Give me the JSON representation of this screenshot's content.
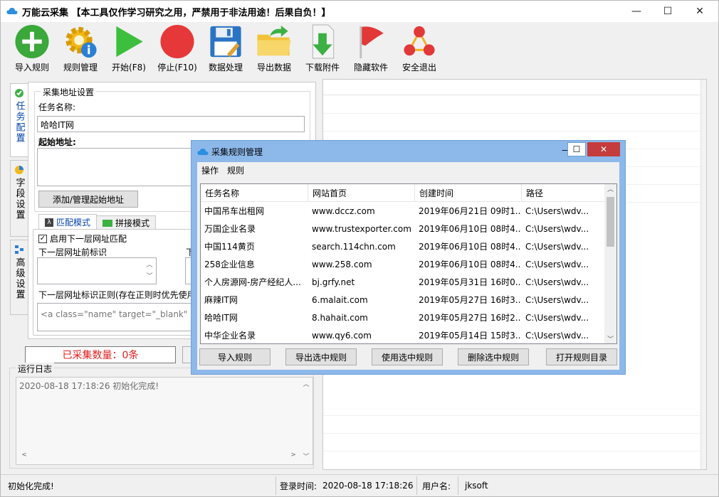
{
  "window": {
    "title": "万能云采集 【本工具仅作学习研究之用，严禁用于非法用途！后果自负！】",
    "minimize": "—",
    "maximize": "☐",
    "close": "✕"
  },
  "toolbar": {
    "items": [
      {
        "label": "导入规则",
        "icon": "add-circle-icon"
      },
      {
        "label": "规则管理",
        "icon": "gear-info-icon"
      },
      {
        "label": "开始(F8)",
        "icon": "play-icon"
      },
      {
        "label": "停止(F10)",
        "icon": "stop-icon"
      },
      {
        "label": "数据处理",
        "icon": "floppy-disk-icon"
      },
      {
        "label": "导出数据",
        "icon": "folder-export-icon"
      },
      {
        "label": "下载附件",
        "icon": "download-icon"
      },
      {
        "label": "隐藏软件",
        "icon": "red-flag-icon"
      },
      {
        "label": "安全退出",
        "icon": "exit-molecule-icon"
      }
    ]
  },
  "left_tabs": [
    {
      "label": "任务配置",
      "active": true
    },
    {
      "label": "字段设置",
      "active": false
    },
    {
      "label": "高级设置",
      "active": false
    }
  ],
  "task_config": {
    "group_title": "采集地址设置",
    "task_name_label": "任务名称:",
    "task_name_value": "哈哈IT网",
    "start_url_label": "起始地址:",
    "start_url_value": "",
    "add_url_button": "添加/管理起始地址",
    "mode_tabs": [
      "匹配模式",
      "拼接模式"
    ],
    "enable_next_level": "启用下一层网址匹配",
    "next_prefix_label": "下一层网址前标识",
    "next_suffix_label_partial": "下",
    "regex_label": "下一层网址标识正则(存在正则时优先使用",
    "regex_value": "<a class=\"name\" target=\"_blank\" hre"
  },
  "collected_count": "已采集数量：0条",
  "log": {
    "title": "运行日志",
    "entries": [
      "2020-08-18 17:18:26 初始化完成!"
    ]
  },
  "statusbar": {
    "status": "初始化完成!",
    "login_time_label": "登录时间:",
    "login_time_value": "2020-08-18 17:18:26",
    "user_label": "用户名:",
    "user_value": "jksoft"
  },
  "dialog": {
    "title": "采集规则管理",
    "menu": [
      "操作",
      "规则"
    ],
    "columns": [
      "任务名称",
      "网站首页",
      "创建时间",
      "路径"
    ],
    "rows": [
      [
        "中国吊车出租网",
        "www.dccz.com",
        "2019年06月21日 09时1...",
        "C:\\Users\\wdv..."
      ],
      [
        "万国企业名录",
        "www.trustexporter.com",
        "2019年06月10日 08时4...",
        "C:\\Users\\wdv..."
      ],
      [
        "中国114黄页",
        "search.114chn.com",
        "2019年06月10日 08时4...",
        "C:\\Users\\wdv..."
      ],
      [
        "258企业信息",
        "www.258.com",
        "2019年06月10日 08时4...",
        "C:\\Users\\wdv..."
      ],
      [
        "个人房源网-房产经纪人...",
        "bj.grfy.net",
        "2019年05月31日 16时0...",
        "C:\\Users\\wdv..."
      ],
      [
        "麻辣IT网",
        "6.malait.com",
        "2019年05月27日 16时3...",
        "C:\\Users\\wdv..."
      ],
      [
        "哈哈IT网",
        "8.hahait.com",
        "2019年05月27日 16时2...",
        "C:\\Users\\wdv..."
      ],
      [
        "中华企业名录",
        "www.qy6.com",
        "2019年05月14日 15时3...",
        "C:\\Users\\wdv..."
      ]
    ],
    "buttons": [
      "导入规则",
      "导出选中规则",
      "使用选中规则",
      "删除选中规则",
      "打开规则目录"
    ]
  }
}
